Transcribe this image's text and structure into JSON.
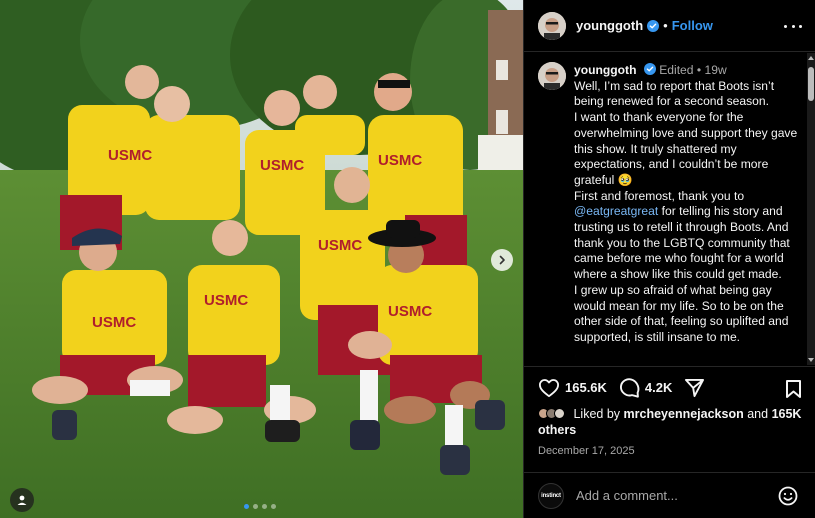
{
  "post": {
    "username": "younggoth",
    "follow_label": "Follow",
    "dot": "•",
    "edited_label": "Edited",
    "age": "19w",
    "caption_lines": [
      "Well, I’m sad to report that Boots isn’t being renewed for a second season.",
      "I want to thank everyone for the overwhelming love and support they gave this show. It truly shattered my expectations, and I couldn’t be more grateful 🥹",
      "First and foremost, thank you to",
      "for telling his story and trusting us to retell it through Boots. And thank you to the LGBTQ community that came before me who fought for a world where a show like this could get made.",
      "I grew up so afraid of what being gay would mean for my life. So to be on the other side of that, feeling so uplifted and supported, is still insane to me."
    ],
    "mention": "@eatgreatgreat",
    "mention_text": "@eatgreatgreat"
  },
  "actions": {
    "likes_count": "165.6K",
    "comments_count": "4.2K"
  },
  "liked_by": {
    "prefix": "Liked by",
    "user": "mrcheyennejackson",
    "and": "and",
    "count": "165K",
    "suffix": "others"
  },
  "date": "December 17, 2025",
  "comment_box": {
    "placeholder": "Add a comment...",
    "avatar_text": "instinct"
  },
  "photo": {
    "shirt_text": "USMC",
    "carousel_dots": 4,
    "active_dot": 0
  },
  "colors": {
    "accent": "#3797f0",
    "shirt": "#f2d21c",
    "shorts": "#a3182a",
    "grass": "#4f7d2c"
  },
  "icons": [
    "more-icon",
    "verified-icon",
    "heart-icon",
    "comment-icon",
    "share-icon",
    "bookmark-icon",
    "emoji-icon",
    "chevron-right-icon",
    "user-tag-icon"
  ]
}
